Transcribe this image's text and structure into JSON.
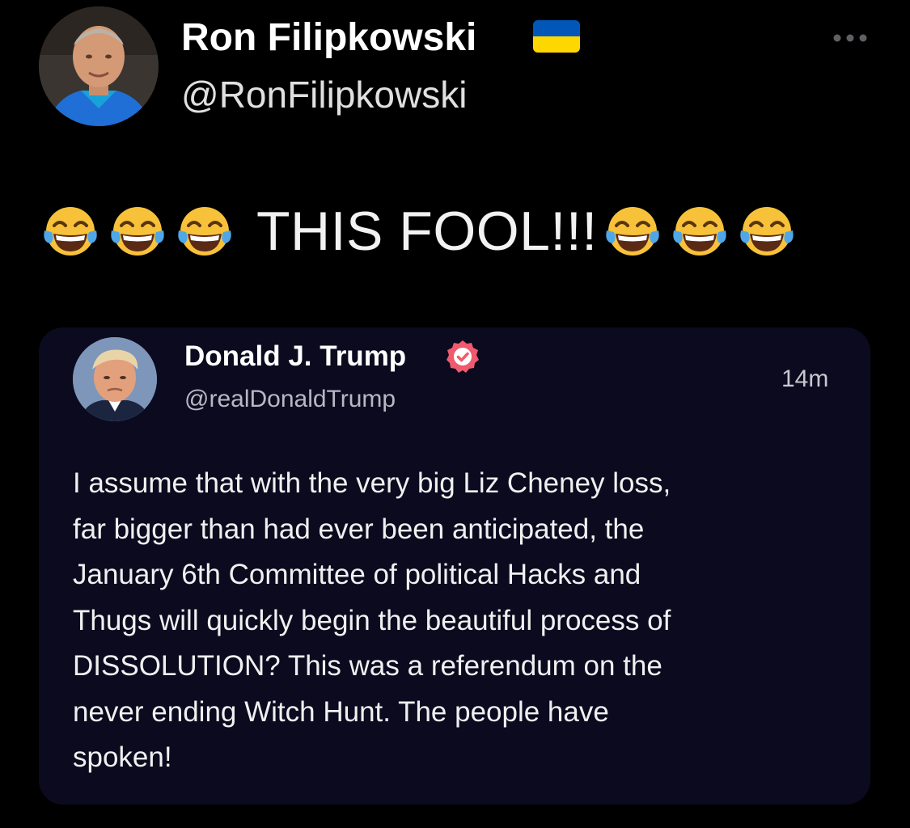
{
  "author": {
    "display_name": "Ron Filipkowski",
    "handle": "@RonFilipkowski",
    "flag_icon": "ukraine-flag-icon",
    "flag_colors": [
      "#0057b7",
      "#ffd700"
    ],
    "more_icon": "ellipsis-icon"
  },
  "tweet": {
    "text": "THIS FOOL!!!",
    "emoji_icon": "face-with-tears-of-joy-icon",
    "emoji_count_before": 3,
    "emoji_count_after": 3
  },
  "quoted_post": {
    "display_name": "Donald J. Trump",
    "handle": "@realDonaldTrump",
    "timestamp": "14m",
    "verified_icon": "verified-badge-icon",
    "verified_color": "#f05a6e",
    "card_background": "#0b0a1f",
    "body_lines": [
      "I assume that with the very big Liz Cheney loss,",
      "far bigger than had ever been anticipated, the",
      "January 6th Committee of political Hacks and",
      "Thugs will quickly begin the beautiful process of",
      "DISSOLUTION? This was a referendum on the",
      "never ending Witch Hunt. The people have",
      "spoken!"
    ]
  }
}
